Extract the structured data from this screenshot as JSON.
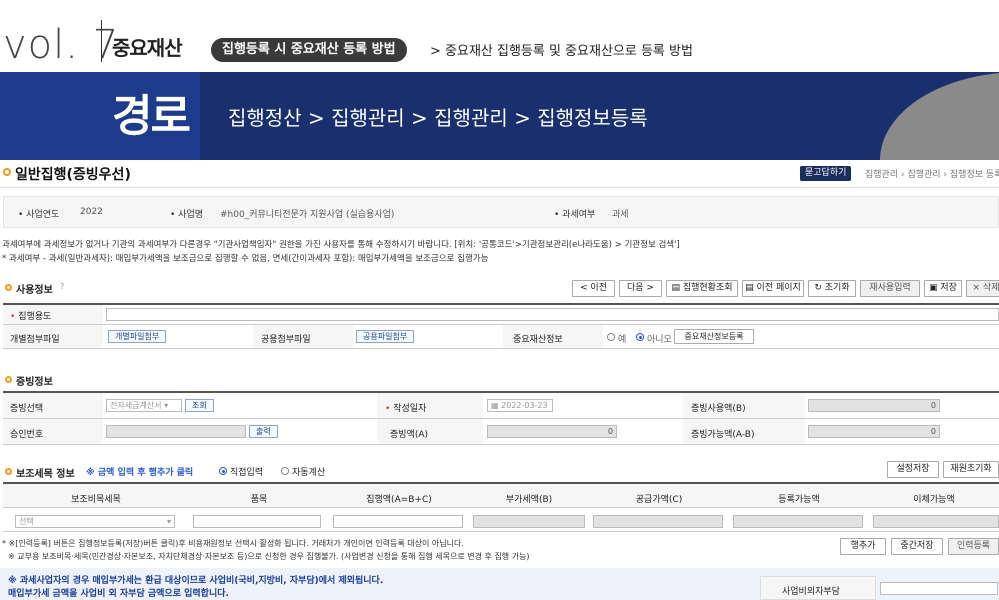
{
  "header": {
    "vol": "vol. 7",
    "topic": "중요재산",
    "pill": "집행등록 시 중요재산 등록 방법",
    "subtopic": "> 중요재산 집행등록 및 중요재산으로 등록 방법"
  },
  "banner": {
    "title": "경로",
    "path": "집행정산 > 집행관리 > 집행관리 > 집행정보등록"
  },
  "page": {
    "title": "일반집행(증빙우선)",
    "ask_button": "묻고답하기",
    "crumbs": "집행관리 › 집행관리 › 집행정보 등록"
  },
  "info": {
    "year_label": "사업연도",
    "year_value": "2022",
    "biz_label": "사업명",
    "biz_value": "#h00_커뮤니티전문가 지원사업 (실습용사업)",
    "tax_label": "과세여부",
    "tax_value": "과세"
  },
  "notes": {
    "line1": "과세여부에 과세정보가 없거나 기관의 과세여부가 다른경우 \"기관사업책임자\" 권한을 가진 사용자를 통해 수정하시기 바랍니다. [위치: '공통코드'>기관정보관리(e나라도움) > 기관정보 검색']",
    "line2": "* 과세여부 - 과세(일반과세자): 매입부가세액을 보조금으로 집행할 수 없음, 면세(간이과세자 포함): 매입부가세액을 보조금으로 집행가능"
  },
  "usage": {
    "title": "사용정보",
    "buttons": [
      "< 이전",
      "다음 >",
      "집행현황조회",
      "이전 페이지",
      "초기화",
      "재사용입력",
      "저장",
      "× 삭제"
    ],
    "purpose_label": "집행용도",
    "file_label": "개별첨부파일",
    "file_btn": "개별파일첨부",
    "common_label": "공용첨부파일",
    "common_btn": "공용파일첨부",
    "asset_label": "중요재산정보",
    "asset_yes": "예",
    "asset_no": "아니오",
    "asset_btn": "중요재산정보등록"
  },
  "evidence": {
    "title": "증빙정보",
    "select_label": "증빙선택",
    "select_value": "전자세금계산서",
    "lookup_btn": "조회",
    "date_label": "작성일자",
    "date_value": "2022-03-23",
    "use_label": "증빙사용액(B)",
    "use_value": "0",
    "approval_label": "승인번호",
    "print_btn": "출력",
    "amount_label": "증빙액(A)",
    "amount_value": "0",
    "avail_label": "증빙가능액(A-B)",
    "avail_value": "0"
  },
  "subsidy": {
    "title": "보조세목 정보",
    "hint": "※ 금액 입력 후 행추가 클릭",
    "radio_direct": "직접입력",
    "radio_auto": "자동계산",
    "btn_save_setting": "설정저장",
    "btn_reset": "재원초기화",
    "headers": [
      "보조비목세목",
      "품목",
      "집행액(A=B+C)",
      "부가세액(B)",
      "공급가액(C)",
      "등록가능액",
      "이체가능액"
    ],
    "select_placeholder": "선택",
    "note1": "* ※[인력등록] 버튼은 집행정보등록(저장)버튼 클릭)후 비용재원정보 선택시 활성화 됩니다. 거래처가 개인이면 인력등록 대상이 아닙니다.",
    "note2": "※ 교부용 보조비목·세목(민간경상·자본보조, 자치단체경상·자본보조 등)으로 신청한 경우 집행불가. (사업변경 신청을 통해 집행 세목으로 변경 후 집행 가능)",
    "btn_addrow": "행추가",
    "btn_temp": "중간저장",
    "btn_staff": "인력등록"
  },
  "tax_notes": {
    "line1": "※ 과세사업자의 경우 매입부가세는 환급 대상이므로 사업비(국비,지방비, 자부담)에서 제외됩니다.",
    "line2": "매입부가세 금액을 사업비 외 자부담 금액으로 입력합니다.",
    "outside_label": "사업비외자부담"
  }
}
